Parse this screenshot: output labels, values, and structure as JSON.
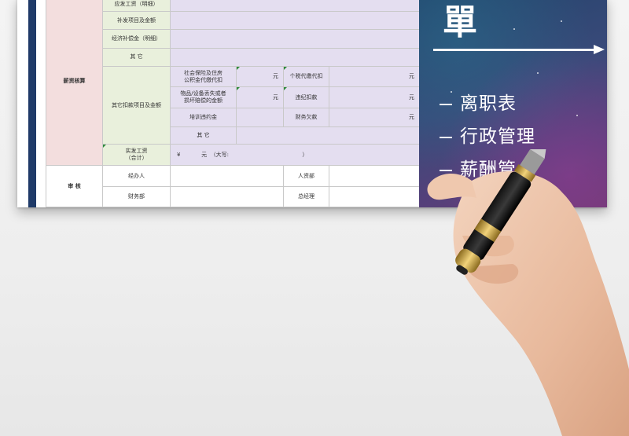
{
  "form": {
    "section_salary": "薪资核算",
    "section_review": "审 核",
    "row_payable": "应发工资（明细）",
    "row_supplement": "补发项目及金额",
    "row_compensation": "经济补偿金（明细）",
    "row_other1": "其 它",
    "row_deductions": "其它扣款项目及金额",
    "deduct_social_l1": "社会保险及住房",
    "deduct_social_l2": "公积金代缴代扣",
    "deduct_tax": "个税代缴代扣",
    "deduct_goods_l1": "物品/设备丢失或者",
    "deduct_goods_l2": "损坏赔偿的金额",
    "deduct_violation": "违纪扣款",
    "deduct_training": "培训违约金",
    "deduct_debt": "财务欠款",
    "deduct_other": "其 它",
    "unit_yuan": "元",
    "row_actual_l1": "实发工资",
    "row_actual_l2": "（合计）",
    "actual_value": "¥            元  （大写:                                          ）",
    "review_handler": "经办人",
    "review_hr": "人资部",
    "review_finance": "财务部",
    "review_gm": "总经理"
  },
  "banner": {
    "big_char": "單",
    "items": [
      "离职表",
      "行政管理",
      "薪酬管"
    ]
  },
  "colors": {
    "strip": "#1f3a68",
    "pink": "#f3dede",
    "green": "#e9f0dc",
    "lavender": "#e4def0"
  }
}
